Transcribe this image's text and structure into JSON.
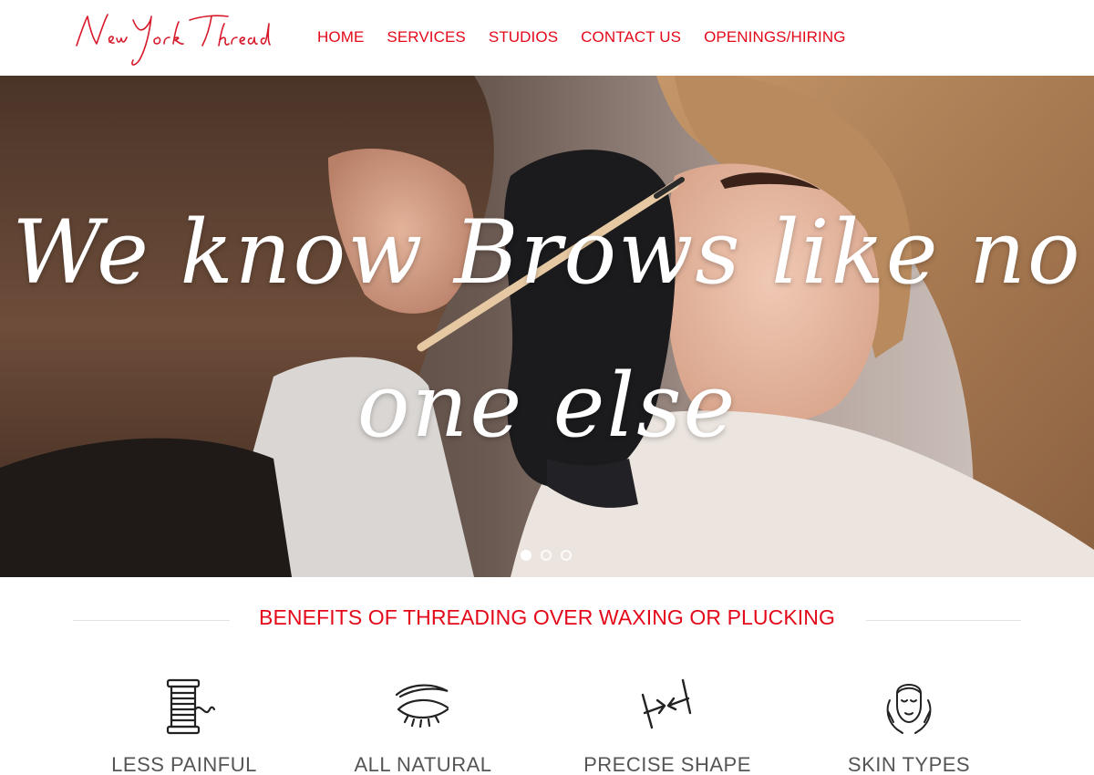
{
  "brand": {
    "logo_text": "New York Thread",
    "accent": "#e3091a"
  },
  "nav": {
    "items": [
      "HOME",
      "SERVICES",
      "STUDIOS",
      "CONTACT US",
      "OPENINGS/HIRING"
    ]
  },
  "hero": {
    "line1": "We know Brows like no",
    "line2": "one else",
    "slides": {
      "count": 3,
      "active": 1
    }
  },
  "benefits": {
    "heading": "BENEFITS OF THREADING OVER WAXING OR PLUCKING",
    "items": [
      {
        "label": "LESS PAINFUL",
        "icon": "thread-spool-icon"
      },
      {
        "label": "ALL NATURAL",
        "icon": "eye-brow-icon"
      },
      {
        "label": "PRECISE SHAPE",
        "icon": "precision-arrows-icon"
      },
      {
        "label": "SKIN TYPES",
        "icon": "face-care-icon"
      }
    ]
  }
}
